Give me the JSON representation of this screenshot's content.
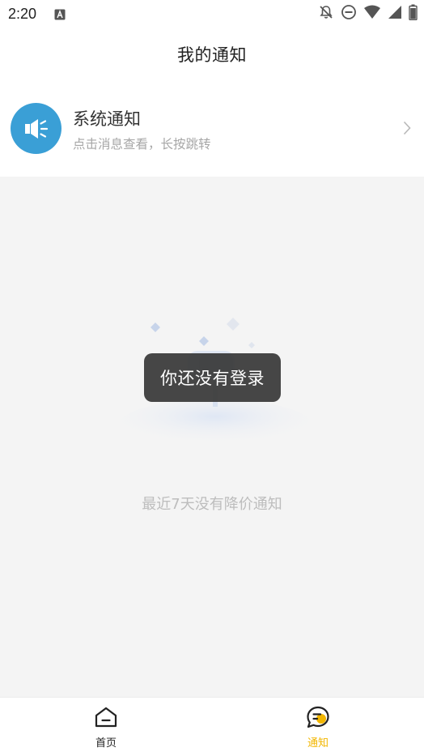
{
  "status_bar": {
    "time": "2:20",
    "icons": [
      "app-a-icon",
      "notifications-off-icon",
      "do-not-disturb-icon",
      "wifi-icon",
      "signal-icon",
      "battery-icon"
    ]
  },
  "header": {
    "title": "我的通知"
  },
  "system_notice": {
    "icon": "megaphone-icon",
    "title": "系统通知",
    "subtitle": "点击消息查看，长按跳转"
  },
  "empty_state": {
    "message": "最近7天没有降价通知"
  },
  "toast": {
    "message": "你还没有登录"
  },
  "tab_bar": {
    "items": [
      {
        "label": "首页",
        "icon": "home-icon",
        "active": false
      },
      {
        "label": "通知",
        "icon": "message-icon",
        "active": true
      }
    ]
  },
  "colors": {
    "accent": "#f2b600",
    "notice_icon_bg": "#3a9fd6",
    "content_bg": "#f4f4f4"
  }
}
